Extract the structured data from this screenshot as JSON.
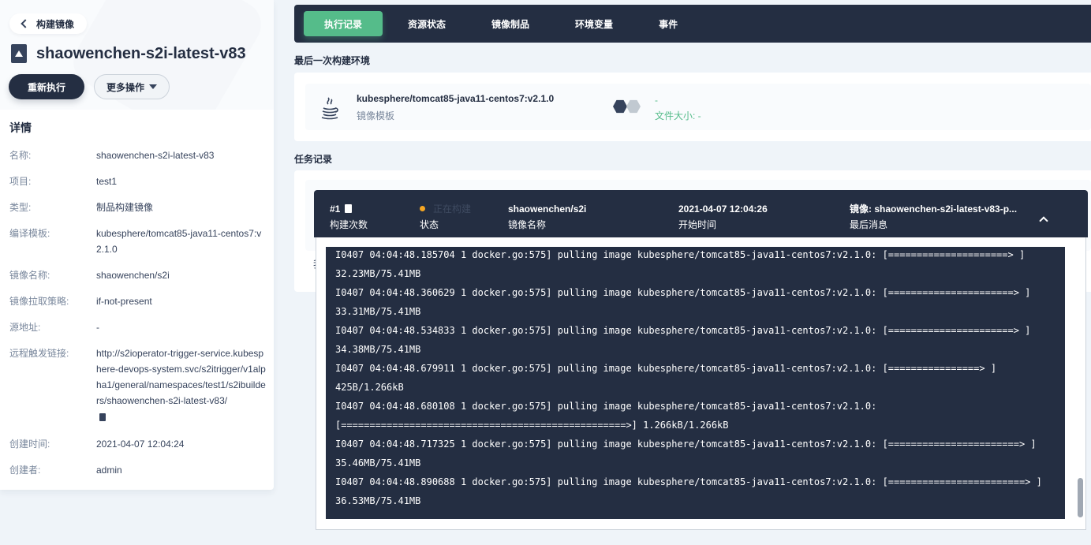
{
  "left": {
    "back_label": "构建镜像",
    "name": "shaowenchen-s2i-latest-v83",
    "rerun_label": "重新执行",
    "more_label": "更多操作",
    "details_title": "详情",
    "details": [
      {
        "k": "名称:",
        "v": "shaowenchen-s2i-latest-v83"
      },
      {
        "k": "项目:",
        "v": "test1"
      },
      {
        "k": "类型:",
        "v": "制品构建镜像"
      },
      {
        "k": "编译模板:",
        "v": "kubesphere/tomcat85-java11-centos7:v2.1.0"
      },
      {
        "k": "镜像名称:",
        "v": "shaowenchen/s2i"
      },
      {
        "k": "镜像拉取策略:",
        "v": "if-not-present"
      },
      {
        "k": "源地址:",
        "v": "-"
      },
      {
        "k": "远程触发链接:",
        "v": "http://s2ioperator-trigger-service.kubesphere-devops-system.svc/s2itrigger/v1alpha1/general/namespaces/test1/s2ibuilders/shaowenchen-s2i-latest-v83/"
      },
      {
        "k": "创建时间:",
        "v": "2021-04-07 12:04:24"
      },
      {
        "k": "创建者:",
        "v": "admin"
      }
    ]
  },
  "tabs": [
    "执行记录",
    "资源状态",
    "镜像制品",
    "环境变量",
    "事件"
  ],
  "env": {
    "section_title": "最后一次构建环境",
    "image": "kubesphere/tomcat85-java11-centos7:v2.1.0",
    "image_label": "镜像模板",
    "status_dash": "-",
    "file_size": "文件大小: -"
  },
  "tasks": {
    "section_title": "任务记录",
    "run_no": "#1",
    "run_no_label": "构建次数",
    "status_value": "正在构建",
    "status_label": "状态",
    "image_name": "shaowenchen/s2i",
    "image_name_label": "镜像名称",
    "start_time": "2021-04-07 12:04:26",
    "start_time_label": "开始时间",
    "last_msg": "镜像: shaowenchen-s2i-latest-v83-p...",
    "last_msg_label": "最后消息"
  },
  "log_lines": [
    "I0407 04:04:48.185704 1 docker.go:575] pulling image kubesphere/tomcat85-java11-centos7:v2.1.0: [=====================> ]",
    "32.23MB/75.41MB",
    "I0407 04:04:48.360629 1 docker.go:575] pulling image kubesphere/tomcat85-java11-centos7:v2.1.0: [======================> ]",
    "33.31MB/75.41MB",
    "I0407 04:04:48.534833 1 docker.go:575] pulling image kubesphere/tomcat85-java11-centos7:v2.1.0: [======================> ]",
    "34.38MB/75.41MB",
    "I0407 04:04:48.679911 1 docker.go:575] pulling image kubesphere/tomcat85-java11-centos7:v2.1.0: [================> ]",
    "425B/1.266kB",
    "I0407 04:04:48.680108 1 docker.go:575] pulling image kubesphere/tomcat85-java11-centos7:v2.1.0:",
    "[==================================================>] 1.266kB/1.266kB",
    "I0407 04:04:48.717325 1 docker.go:575] pulling image kubesphere/tomcat85-java11-centos7:v2.1.0: [=======================> ]",
    "35.46MB/75.41MB",
    "I0407 04:04:48.890688 1 docker.go:575] pulling image kubesphere/tomcat85-java11-centos7:v2.1.0: [========================> ]",
    "36.53MB/75.41MB"
  ],
  "colors": {
    "accent": "#55bc8a",
    "dark": "#242e42",
    "running": "#f5a623"
  }
}
